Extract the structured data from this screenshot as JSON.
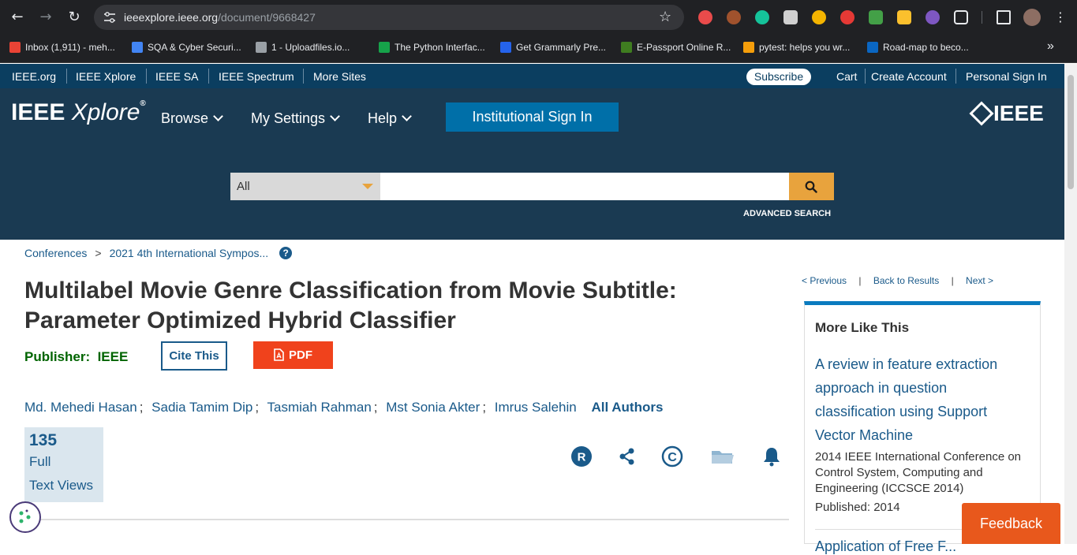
{
  "browser": {
    "url_domain": "ieeexplore.ieee.org",
    "url_path": "/document/9668427",
    "bookmarks": [
      {
        "label": "Inbox (1,911) - meh...",
        "color": "#ea4335"
      },
      {
        "label": "SQA & Cyber Securi...",
        "color": "#4285f4"
      },
      {
        "label": "1 - Uploadfiles.io...",
        "color": "#9aa0a6"
      },
      {
        "label": "The Python Interfac...",
        "color": "#16a34a"
      },
      {
        "label": "Get Grammarly Pre...",
        "color": "#2563eb"
      },
      {
        "label": "E-Passport Online R...",
        "color": "#3f7d20"
      },
      {
        "label": "pytest: helps you wr...",
        "color": "#f59e0b"
      },
      {
        "label": "Road-map to beco...",
        "color": "#0a66c2"
      }
    ],
    "bookmarks_more": "»"
  },
  "topbar": {
    "links": [
      "IEEE.org",
      "IEEE Xplore",
      "IEEE SA",
      "IEEE Spectrum",
      "More Sites"
    ],
    "subscribe": "Subscribe",
    "cart": "Cart",
    "create_account": "Create Account",
    "sign_in": "Personal Sign In"
  },
  "header": {
    "logo_main": "IEEE ",
    "logo_italic": "Xplore",
    "logo_reg": "®",
    "menu": [
      "Browse",
      "My Settings",
      "Help"
    ],
    "institutional": "Institutional Sign In",
    "brand": "IEEE",
    "search_scope": "All",
    "search_placeholder": "",
    "advanced": "ADVANCED SEARCH"
  },
  "breadcrumb": {
    "items": [
      "Conferences",
      "2021 4th International Sympos..."
    ],
    "separator": ">",
    "help": "?"
  },
  "article": {
    "title": "Multilabel Movie Genre Classification from Movie Subtitle: Parameter Optimized Hybrid Classifier",
    "publisher_label": "Publisher:",
    "publisher": "IEEE",
    "cite": "Cite This",
    "pdf": "PDF",
    "authors": [
      "Md. Mehedi Hasan",
      "Sadia Tamim Dip",
      "Tasmiah Rahman",
      "Mst Sonia Akter",
      "Imrus Salehin"
    ],
    "author_sep": ";",
    "all_authors": "All Authors",
    "views_count": "135",
    "views_line1": "Full",
    "views_line2": "Text Views",
    "rights_letter": "R",
    "copyright_glyph": "©"
  },
  "pager": {
    "previous": "< Previous",
    "back": "Back to Results",
    "next": "Next >",
    "bar": "|"
  },
  "more_like_this": {
    "heading": "More Like This",
    "link": "A review in feature extraction approach in question classification using Support Vector Machine",
    "venue": "2014 IEEE International Conference on Control System, Computing and Engineering (ICCSCE 2014)",
    "published": "Published: 2014",
    "next_link": "Application of Free F..."
  },
  "feedback": "Feedback",
  "colors": {
    "accent_blue": "#006fa8",
    "header_dark": "#1a3a52",
    "pdf_red": "#f0421c",
    "feedback_orange": "#e8581c",
    "publisher_green": "#006400",
    "search_gold": "#e8a33d"
  }
}
